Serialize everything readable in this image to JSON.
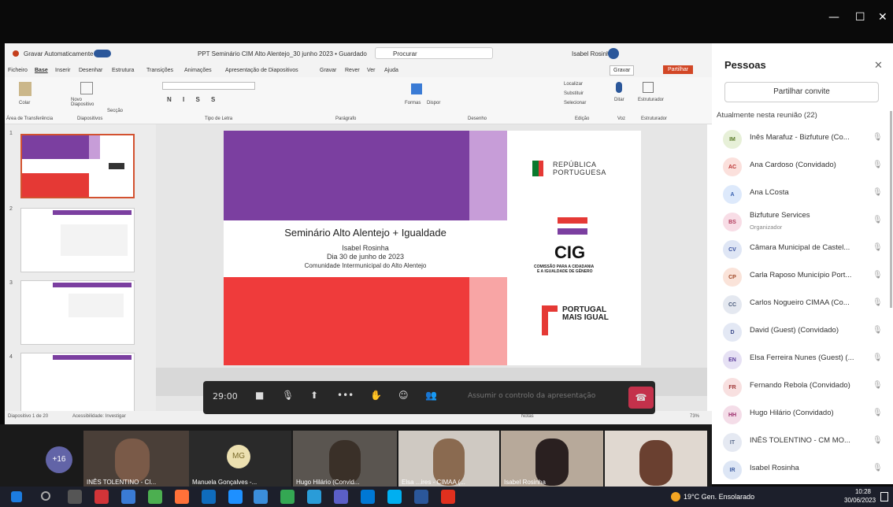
{
  "window": {
    "min": "—",
    "max": "☐",
    "close": "✕"
  },
  "ppt": {
    "autosave": "Gravar Automaticamente",
    "filename": "PPT Seminário CIM Alto Alentejo_30 junho 2023 • Guardado",
    "search": "Procurar",
    "user": "Isabel Rosinha",
    "tabs": [
      "Ficheiro",
      "Base",
      "Inserir",
      "Desenhar",
      "Estrutura",
      "Transições",
      "Animações",
      "Apresentação de Diapositivos",
      "Gravar",
      "Rever",
      "Ver",
      "Ajuda"
    ],
    "record_btn": "Gravar",
    "share_btn": "Partilhar",
    "groups": [
      "Área de Transferência",
      "Diapositivos",
      "Tipo de Letra",
      "Parágrafo",
      "Desenho",
      "Edição",
      "Voz",
      "Estruturador"
    ],
    "ribbon_items": {
      "paste": "Colar",
      "new_slide": "Novo Diapositivo",
      "section": "Secção",
      "shapes": "Formas",
      "arrange": "Dispor",
      "find": "Localizar",
      "replace": "Substituir",
      "select": "Selecionar",
      "dictate": "Ditar",
      "designer": "Estruturador"
    },
    "thumb_numbers": [
      "1",
      "2",
      "3",
      "4"
    ],
    "status_left": "Diapositivo 1 de 20",
    "status_access": "Acessibilidade: Investigar",
    "notes_label": "Notas",
    "zoom": "73%"
  },
  "slide": {
    "title": "Seminário Alto Alentejo + Igualdade",
    "presenter": "Isabel Rosinha",
    "date": "Dia 30 de junho de 2023",
    "org": "Comunidade Intermunicipal do Alto Alentejo",
    "logo1_a": "REPÚBLICA",
    "logo1_b": "PORTUGUESA",
    "logo2": "CIG",
    "logo2_sub_a": "COMISSÃO PARA A CIDADANIA",
    "logo2_sub_b": "E A IGUALDADE DE GÉNERO",
    "logo3_a": "PORTUGAL",
    "logo3_b": "MAIS IGUAL"
  },
  "meeting": {
    "timer": "29:00",
    "take_control": "Assumir o controlo da apresentação",
    "overflow_count": "+16",
    "tiles": [
      {
        "label": "INÊS TOLENTINO - CI..."
      },
      {
        "initials": "MG",
        "label": "Manuela Gonçalves -..."
      },
      {
        "label": "Hugo Hilário (Convid..."
      },
      {
        "label": "Elsa ...ires - CIMAA (..."
      },
      {
        "label": "Isabel Rosinha"
      }
    ]
  },
  "people": {
    "title": "Pessoas",
    "share_invite": "Partilhar convite",
    "section": "Atualmente nesta reunião (22)",
    "list": [
      {
        "initials": "IM",
        "name": "Inês Marafuz - Bizfuture (Co...",
        "color": "#e7f0d8",
        "fg": "#5a7a2a"
      },
      {
        "initials": "AC",
        "name": "Ana Cardoso (Convidado)",
        "color": "#fbe0dc",
        "fg": "#b33"
      },
      {
        "initials": "A",
        "name": "Ana LCosta",
        "color": "#dde9fb",
        "fg": "#3a62b0"
      },
      {
        "initials": "BS",
        "name": "Bizfuture Services",
        "role": "Organizador",
        "color": "#f8dde6",
        "fg": "#b03a5a"
      },
      {
        "initials": "CV",
        "name": "Câmara Municipal de Castel...",
        "color": "#dfe6f5",
        "fg": "#3a52a0"
      },
      {
        "initials": "CP",
        "name": "Carla Raposo Município Port...",
        "color": "#fae3d9",
        "fg": "#a04a2a"
      },
      {
        "initials": "CC",
        "name": "Carlos Nogueiro CIMAA (Co...",
        "color": "#e4e8f0",
        "fg": "#4a5a7a"
      },
      {
        "initials": "D",
        "name": "David (Guest) (Convidado)",
        "color": "#e3e8f4",
        "fg": "#3a4a8a"
      },
      {
        "initials": "EN",
        "name": "Elsa Ferreira Nunes (Guest) (...",
        "color": "#e6e1f4",
        "fg": "#5a3a9a"
      },
      {
        "initials": "FR",
        "name": "Fernando Rebola (Convidado)",
        "color": "#f8e0e0",
        "fg": "#a03a3a"
      },
      {
        "initials": "HH",
        "name": "Hugo Hilário (Convidado)",
        "color": "#f4dde8",
        "fg": "#9a2a6a"
      },
      {
        "initials": "IT",
        "name": "INÊS TOLENTINO - CM MO...",
        "color": "#e5e9f2",
        "fg": "#5a6a8a"
      },
      {
        "initials": "IR",
        "name": "Isabel Rosinha",
        "color": "#dde6f5",
        "fg": "#3a5aa0"
      }
    ]
  },
  "taskbar": {
    "weather": "19°C Gen. Ensolarado",
    "time": "10:28",
    "date": "30/06/2023"
  }
}
